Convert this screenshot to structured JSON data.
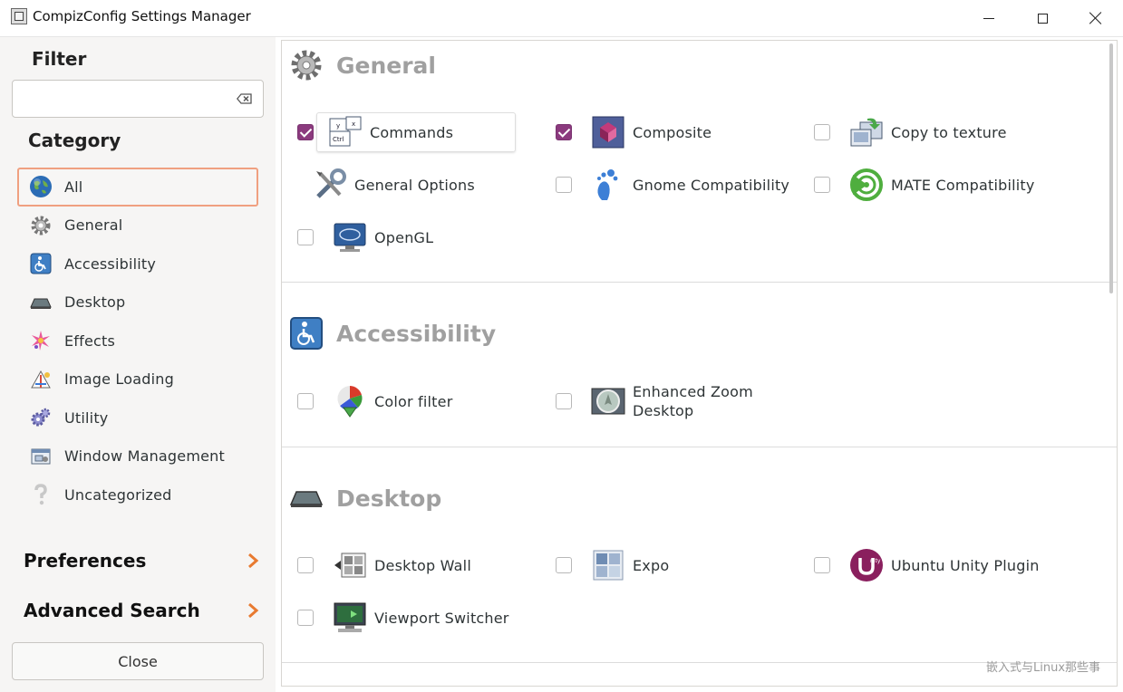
{
  "window": {
    "title": "CompizConfig Settings Manager",
    "controls": {
      "minimize": "minimize",
      "maximize": "maximize",
      "close": "close"
    }
  },
  "sidebar": {
    "filter_heading": "Filter",
    "filter_value": "",
    "category_heading": "Category",
    "categories": [
      {
        "label": "All",
        "icon": "globe-icon",
        "selected": true
      },
      {
        "label": "General",
        "icon": "gear-icon",
        "selected": false
      },
      {
        "label": "Accessibility",
        "icon": "wheelchair-icon",
        "selected": false
      },
      {
        "label": "Desktop",
        "icon": "desktop-icon",
        "selected": false
      },
      {
        "label": "Effects",
        "icon": "sparkle-icon",
        "selected": false
      },
      {
        "label": "Image Loading",
        "icon": "image-loading-icon",
        "selected": false
      },
      {
        "label": "Utility",
        "icon": "utility-gears-icon",
        "selected": false
      },
      {
        "label": "Window Management",
        "icon": "window-management-icon",
        "selected": false
      },
      {
        "label": "Uncategorized",
        "icon": "question-mark-icon",
        "selected": false
      }
    ],
    "preferences_label": "Preferences",
    "advanced_search_label": "Advanced Search",
    "close_label": "Close"
  },
  "sections": {
    "general": {
      "title": "General",
      "plugins": [
        {
          "label": "Commands",
          "enabled": true,
          "icon": "commands-keyboard-icon"
        },
        {
          "label": "Composite",
          "enabled": true,
          "icon": "composite-icon"
        },
        {
          "label": "Copy to texture",
          "enabled": false,
          "icon": "copy-to-texture-icon"
        },
        {
          "label": "General Options",
          "icon": "tools-icon"
        },
        {
          "label": "Gnome Compatibility",
          "enabled": false,
          "icon": "gnome-foot-icon"
        },
        {
          "label": "MATE Compatibility",
          "enabled": false,
          "icon": "mate-icon"
        },
        {
          "label": "OpenGL",
          "enabled": false,
          "icon": "opengl-monitor-icon"
        }
      ]
    },
    "accessibility": {
      "title": "Accessibility",
      "plugins": [
        {
          "label": "Color filter",
          "enabled": false,
          "icon": "color-filter-icon"
        },
        {
          "label_line1": "Enhanced Zoom",
          "label_line2": "Desktop",
          "enabled": false,
          "icon": "enhanced-zoom-icon"
        }
      ]
    },
    "desktop": {
      "title": "Desktop",
      "plugins": [
        {
          "label": "Desktop Wall",
          "enabled": false,
          "icon": "desktop-wall-icon"
        },
        {
          "label": "Expo",
          "enabled": false,
          "icon": "expo-grid-icon"
        },
        {
          "label": "Ubuntu Unity Plugin",
          "enabled": false,
          "icon": "unity-icon"
        },
        {
          "label": "Viewport Switcher",
          "enabled": false,
          "icon": "viewport-switcher-icon"
        }
      ]
    }
  },
  "colors": {
    "accent": "#8b3a7e",
    "selection_border": "#f0a080",
    "section_title": "#a0a0a0"
  },
  "watermark": "嵌入式与Linux那些事"
}
